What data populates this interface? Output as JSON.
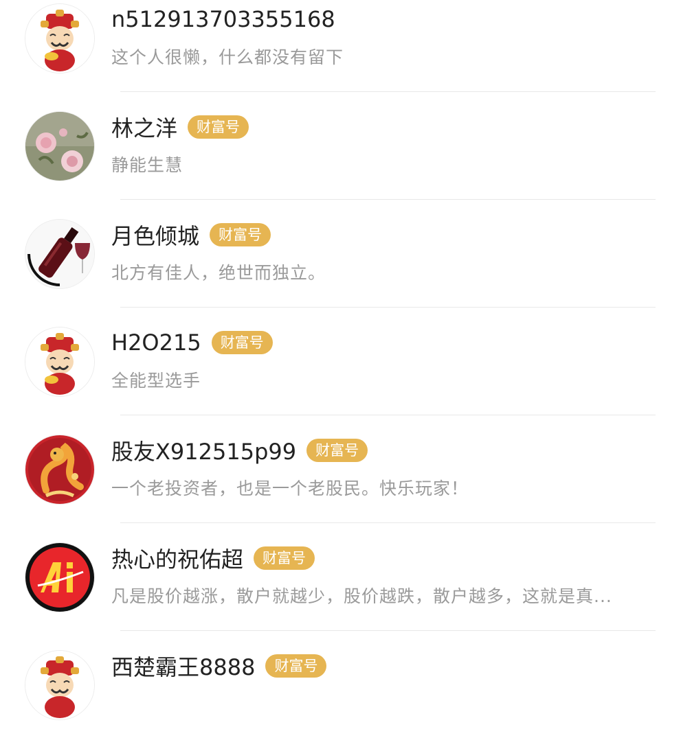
{
  "users": [
    {
      "name": "n512913703355168",
      "bio": "这个人很懒，什么都没有留下",
      "badge": "",
      "avatar": "caishen-avatar"
    },
    {
      "name": "林之洋",
      "bio": "静能生慧",
      "badge": "财富号",
      "avatar": "flower-painting-avatar"
    },
    {
      "name": "月色倾城",
      "bio": "北方有佳人，绝世而独立。",
      "badge": "财富号",
      "avatar": "wine-bottle-avatar"
    },
    {
      "name": "H2O215",
      "bio": "全能型选手",
      "badge": "财富号",
      "avatar": "caishen-avatar"
    },
    {
      "name": "股友X912515p99",
      "bio": "一个老投资者，也是一个老股民。快乐玩家！",
      "badge": "财富号",
      "avatar": "dragon-avatar"
    },
    {
      "name": "热心的祝佑超",
      "bio": "凡是股价越涨，散户就越少，股价越跌，散户越多，这就是真...",
      "badge": "财富号",
      "avatar": "ai-logo-avatar"
    },
    {
      "name": "西楚霸王8888",
      "bio": "",
      "badge": "财富号",
      "avatar": "caishen-avatar"
    }
  ]
}
